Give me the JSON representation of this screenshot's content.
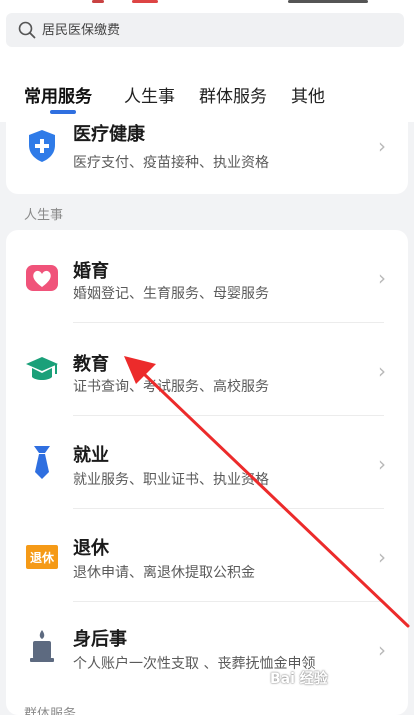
{
  "search": {
    "placeholder": "居民医保缴费"
  },
  "tabs": [
    {
      "label": "常用服务",
      "active": true
    },
    {
      "label": "人生事",
      "active": false
    },
    {
      "label": "群体服务",
      "active": false
    },
    {
      "label": "其他",
      "active": false
    }
  ],
  "colors": {
    "accent": "#2f6fe0",
    "medical": "#2f7be8",
    "marriage": "#f0537a",
    "education": "#1aa079",
    "employment": "#2f6fe0",
    "retire": "#f59a17",
    "funeral": "#5d6a80"
  },
  "top_item": {
    "title": "医疗健康",
    "desc": "医疗支付、疫苗接种、执业资格",
    "icon": "medical-shield-icon"
  },
  "section_life": "人生事",
  "life_items": [
    {
      "title": "婚育",
      "desc": "婚姻登记、生育服务、母婴服务",
      "icon": "heart-people-icon"
    },
    {
      "title": "教育",
      "desc": "证书查询、考试服务、高校服务",
      "icon": "graduation-cap-icon"
    },
    {
      "title": "就业",
      "desc": "就业服务、职业证书、执业资格",
      "icon": "necktie-icon"
    },
    {
      "title": "退休",
      "desc": "退休申请、离退休提取公积金",
      "icon": "retire-badge-icon",
      "badge": "退休"
    },
    {
      "title": "身后事",
      "desc": "个人账户一次性支取 、丧葬抚恤金申领",
      "icon": "candle-icon"
    }
  ],
  "section_group": "群体服务",
  "chevron": "›",
  "watermark": "Bai 经验"
}
